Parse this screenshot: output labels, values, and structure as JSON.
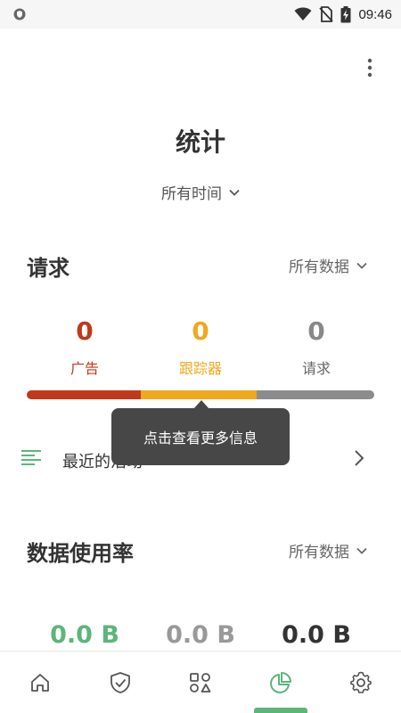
{
  "status_bar": {
    "time": "09:46"
  },
  "header": {
    "title": "统计",
    "period": "所有时间"
  },
  "requests": {
    "title": "请求",
    "filter": "所有数据",
    "stats": [
      {
        "value": "0",
        "label": "广告",
        "color": "#c0391b"
      },
      {
        "value": "0",
        "label": "跟踪器",
        "color": "#f0a81d"
      },
      {
        "value": "0",
        "label": "请求",
        "color": "#888888"
      }
    ]
  },
  "recent": {
    "label": "最近的活动"
  },
  "tooltip": {
    "text": "点击查看更多信息"
  },
  "data_usage": {
    "title": "数据使用率",
    "filter": "所有数据",
    "values": [
      {
        "value": "0.0 B",
        "color": "#5cb57a"
      },
      {
        "value": "0.0 B",
        "color": "#999999"
      },
      {
        "value": "0.0 B",
        "color": "#333333"
      }
    ]
  },
  "bottom_nav": {
    "items": [
      "home-icon",
      "shield-check-icon",
      "apps-icon",
      "statistics-icon",
      "settings-icon"
    ],
    "active_index": 3,
    "accent": "#5cb57a"
  }
}
